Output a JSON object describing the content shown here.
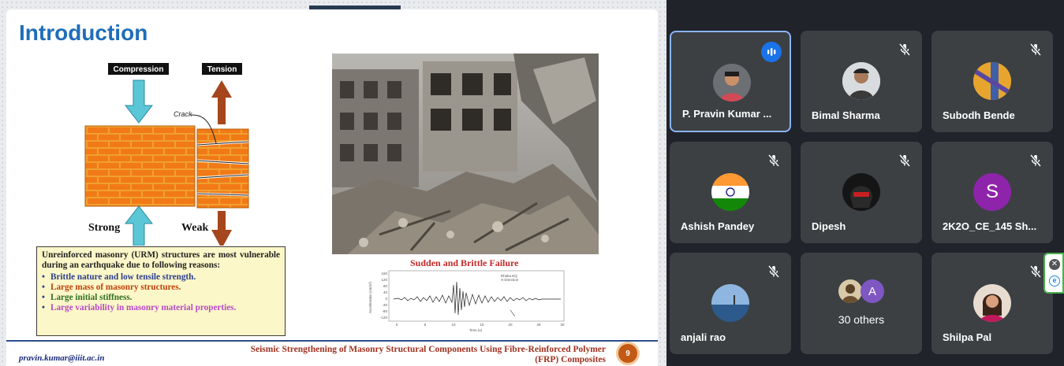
{
  "slide": {
    "title": "Introduction",
    "diagram": {
      "compression_label": "Compression",
      "tension_label": "Tension",
      "crack_label": "Crack",
      "strong_label": "Strong",
      "weak_label": "Weak"
    },
    "photo_caption": "Sudden and Brittle Failure",
    "accelerogram": {
      "legend_line1": "Dhaka EQ",
      "legend_line2": "X-Direction",
      "y_label": "Acceleration (cm/s²)",
      "x_label": "Time (s)",
      "y_ticks": [
        "160",
        "120",
        "80",
        "40",
        "0",
        "-40",
        "-80",
        "-120"
      ],
      "x_ticks": [
        "0",
        "5",
        "10",
        "15",
        "20",
        "25",
        "30"
      ]
    },
    "info_box": {
      "intro": "Unreinforced masonry (URM) structures are most vulnerable during an earthquake due to following reasons:",
      "bullets": [
        "Brittle nature and low tensile strength.",
        "Large mass of masonry structures.",
        "Large initial stiffness.",
        "Large variability in masonry material properties."
      ],
      "bullet_colors": [
        "#2a3e8f",
        "#c0410a",
        "#2e6e24",
        "#b848c8"
      ]
    },
    "footer": {
      "email": "pravin.kumar@iiit.ac.in",
      "title_line1": "Seismic Strengthening of Masonry Structural Components Using Fibre-Reinforced Polymer",
      "title_line2": "(FRP) Composites",
      "page_number": "9"
    }
  },
  "participants": [
    {
      "name": "P. Pravin Kumar ...",
      "state": "speaking",
      "avatar": "photo"
    },
    {
      "name": "Bimal Sharma",
      "state": "muted",
      "avatar": "photo"
    },
    {
      "name": "Subodh Bende",
      "state": "muted",
      "avatar": "photo"
    },
    {
      "name": "Ashish Pandey",
      "state": "muted",
      "avatar": "flag"
    },
    {
      "name": "Dipesh",
      "state": "muted",
      "avatar": "photo"
    },
    {
      "name": "2K2O_CE_145 Sh...",
      "state": "muted",
      "avatar": "letter",
      "initial": "S"
    },
    {
      "name": "anjali rao",
      "state": "muted",
      "avatar": "photo"
    },
    {
      "name": "",
      "state": "group",
      "others_label": "30 others",
      "initial": "A"
    },
    {
      "name": "Shilpa Pal",
      "state": "muted",
      "avatar": "photo"
    }
  ],
  "colors": {
    "app_background": "#20232a",
    "tile_background": "#3c4043",
    "active_border": "#8ab4f8",
    "speaking_indicator": "#1a73e8",
    "slide_title": "#1f6db8",
    "letter_avatar": "#8e24aa"
  },
  "icons": {
    "mic_off": "mic-off-icon",
    "speaking": "audio-bars-icon",
    "widget_close": "close-circle-icon",
    "widget_extension": "extension-e-icon"
  }
}
